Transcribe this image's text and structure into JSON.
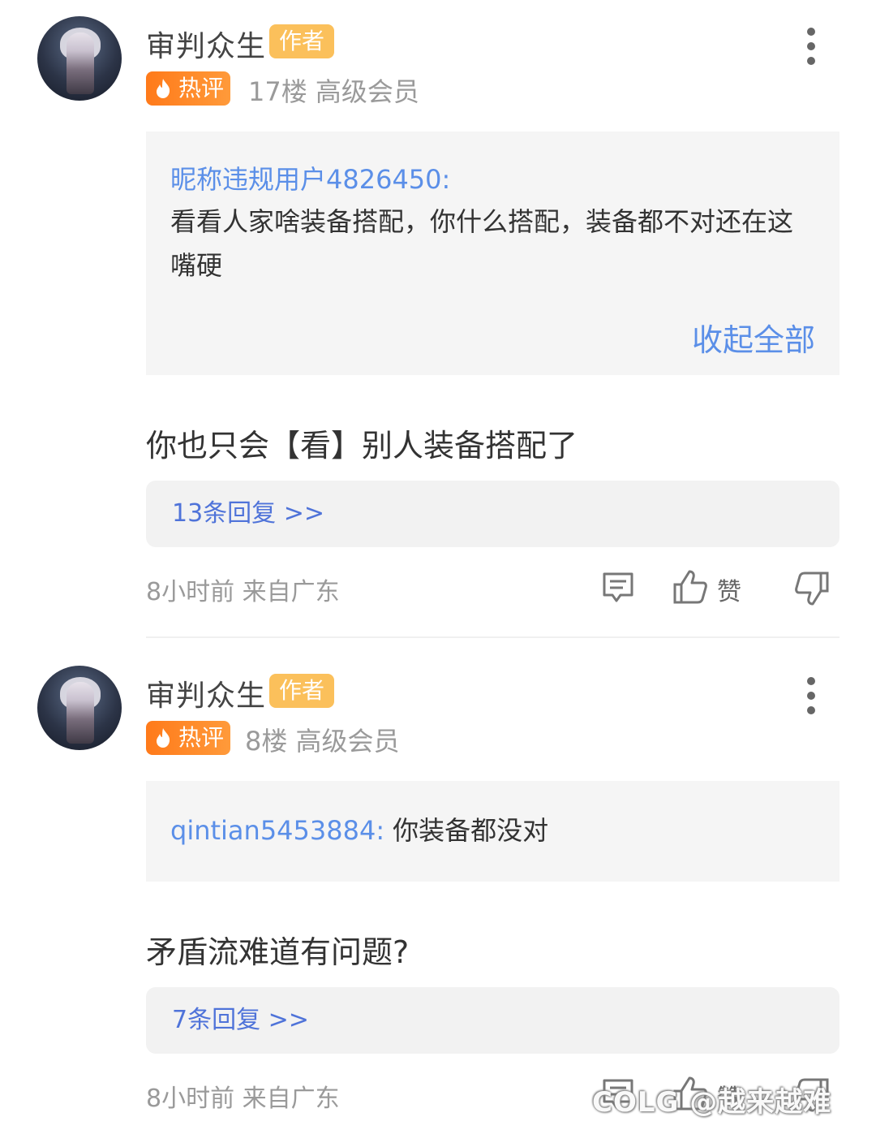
{
  "comments": [
    {
      "username": "审判众生",
      "author_badge": "作者",
      "hot_badge": "热评",
      "floor_level": "17楼 高级会员",
      "quote_user": "昵称违规用户4826450:",
      "quote_text": "看看人家啥装备搭配，你什么搭配，装备都不对还在这嘴硬",
      "collapse_label": "收起全部",
      "body": "你也只会【看】别人装备搭配了",
      "replies": "13条回复 >>",
      "time_location": "8小时前 来自广东",
      "like_label": "赞"
    },
    {
      "username": "审判众生",
      "author_badge": "作者",
      "hot_badge": "热评",
      "floor_level": "8楼 高级会员",
      "quote_user": "qintian5453884:",
      "quote_text": "你装备都没对",
      "body": "矛盾流难道有问题?",
      "replies": "7条回复 >>",
      "time_location": "8小时前 来自广东",
      "like_label": "赞"
    }
  ],
  "watermark": "COLG @越来越难",
  "colors": {
    "link_blue": "#5b8fe8",
    "reply_blue": "#4f73d9",
    "hot_orange": "#ff7a1a",
    "author_gold": "#fbc05b"
  }
}
